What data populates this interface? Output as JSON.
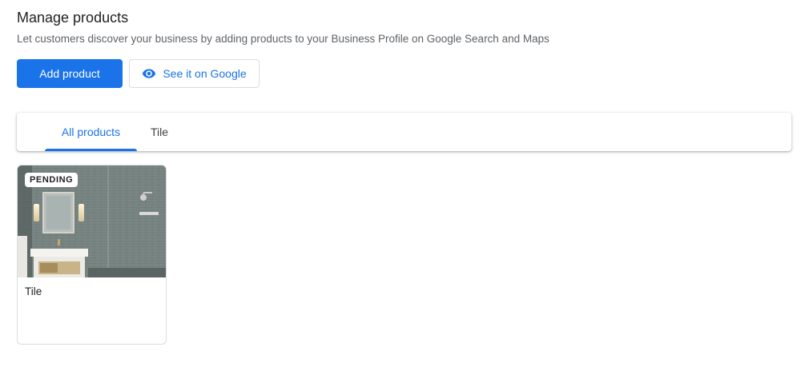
{
  "header": {
    "title": "Manage products",
    "subtitle": "Let customers discover your business by adding products to your Business Profile on Google Search and Maps"
  },
  "actions": {
    "add_product_label": "Add product",
    "see_on_google_label": "See it on Google",
    "see_on_google_icon": "eye-icon"
  },
  "tabs": [
    {
      "label": "All products",
      "active": true
    },
    {
      "label": "Tile",
      "active": false
    }
  ],
  "products": [
    {
      "name": "Tile",
      "status": "PENDING",
      "image": "bathroom-tile-photo"
    }
  ],
  "colors": {
    "accent": "#1a73e8",
    "text_primary": "#202124",
    "text_secondary": "#5f6368",
    "border": "#dadce0"
  }
}
